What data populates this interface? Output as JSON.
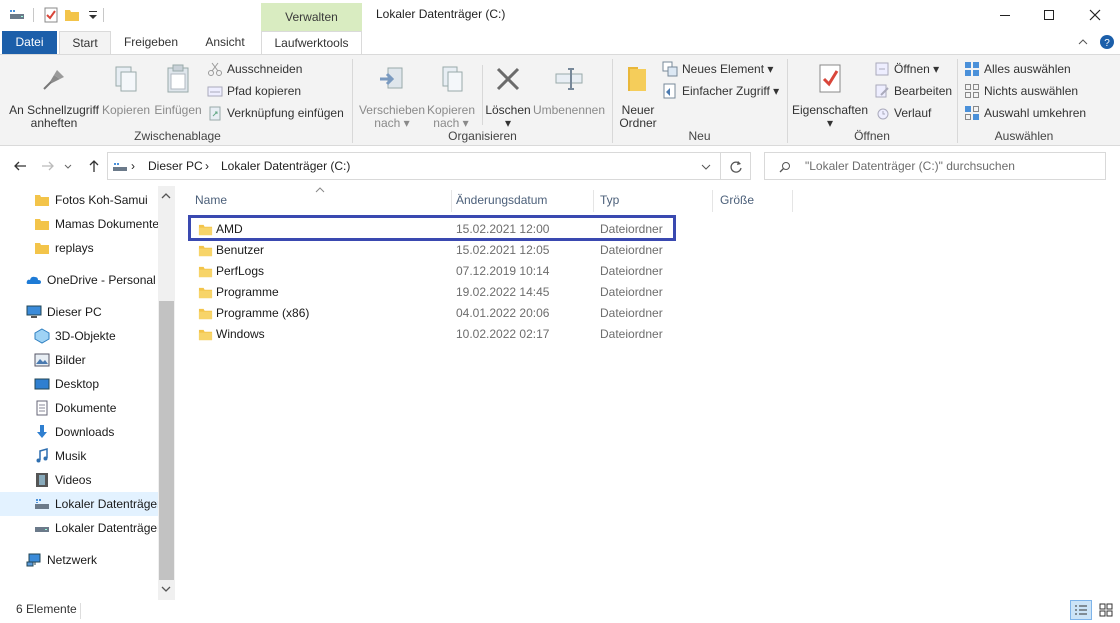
{
  "titlebar": {
    "title": "Lokaler Datenträger (C:)",
    "context_tab": "Verwalten",
    "quick_access": [
      "properties-icon",
      "new-folder-icon",
      "customize-dropdown-icon"
    ]
  },
  "tabs": {
    "datei": "Datei",
    "start": "Start",
    "freigeben": "Freigeben",
    "ansicht": "Ansicht",
    "laufwerktools": "Laufwerktools"
  },
  "ribbon": {
    "clipboard": {
      "label": "Zwischenablage",
      "pin_line1": "An Schnellzugriff",
      "pin_line2": "anheften",
      "copy": "Kopieren",
      "paste": "Einfügen",
      "cut": "Ausschneiden",
      "copy_path": "Pfad kopieren",
      "paste_shortcut": "Verknüpfung einfügen"
    },
    "organize": {
      "label": "Organisieren",
      "move_line1": "Verschieben",
      "move_line2": "nach",
      "copy_line1": "Kopieren",
      "copy_line2": "nach",
      "delete": "Löschen",
      "rename": "Umbenennen"
    },
    "new": {
      "label": "Neu",
      "new_folder_line1": "Neuer",
      "new_folder_line2": "Ordner",
      "new_item": "Neues Element",
      "easy_access": "Einfacher Zugriff"
    },
    "open": {
      "label": "Öffnen",
      "properties": "Eigenschaften",
      "open": "Öffnen",
      "edit": "Bearbeiten",
      "history": "Verlauf"
    },
    "select": {
      "label": "Auswählen",
      "select_all": "Alles auswählen",
      "select_none": "Nichts auswählen",
      "invert": "Auswahl umkehren"
    }
  },
  "address": {
    "crumbs": [
      "Dieser PC",
      "Lokaler Datenträger (C:)"
    ],
    "search_placeholder": "\"Lokaler Datenträger (C:)\" durchsuchen"
  },
  "sidebar": {
    "quick": [
      "Fotos Koh-Samui",
      "Mamas Dokumente",
      "replays"
    ],
    "onedrive": "OneDrive - Personal",
    "thispc": "Dieser PC",
    "pc_items": [
      {
        "label": "3D-Objekte",
        "icon": "3d-objects-icon"
      },
      {
        "label": "Bilder",
        "icon": "pictures-icon"
      },
      {
        "label": "Desktop",
        "icon": "desktop-icon"
      },
      {
        "label": "Dokumente",
        "icon": "documents-icon"
      },
      {
        "label": "Downloads",
        "icon": "downloads-icon"
      },
      {
        "label": "Musik",
        "icon": "music-icon"
      },
      {
        "label": "Videos",
        "icon": "videos-icon"
      },
      {
        "label": "Lokaler Datenträger",
        "icon": "drive-c-icon"
      },
      {
        "label": "Lokaler Datenträger",
        "icon": "drive-icon"
      }
    ],
    "network": "Netzwerk",
    "selected_index": 7
  },
  "columns": {
    "name": "Name",
    "date": "Änderungsdatum",
    "type": "Typ",
    "size": "Größe"
  },
  "files": [
    {
      "name": "AMD",
      "date": "15.02.2021 12:00",
      "type": "Dateiordner"
    },
    {
      "name": "Benutzer",
      "date": "15.02.2021 12:05",
      "type": "Dateiordner"
    },
    {
      "name": "PerfLogs",
      "date": "07.12.2019 10:14",
      "type": "Dateiordner"
    },
    {
      "name": "Programme",
      "date": "19.02.2022 14:45",
      "type": "Dateiordner"
    },
    {
      "name": "Programme (x86)",
      "date": "04.01.2022 20:06",
      "type": "Dateiordner"
    },
    {
      "name": "Windows",
      "date": "10.02.2022 02:17",
      "type": "Dateiordner"
    }
  ],
  "status": {
    "count": "6 Elemente"
  },
  "colors": {
    "accent": "#1c5faa",
    "highlight_box": "#3a49b0",
    "context_tab": "#d9ecc1",
    "folder": "#f3c44a"
  }
}
